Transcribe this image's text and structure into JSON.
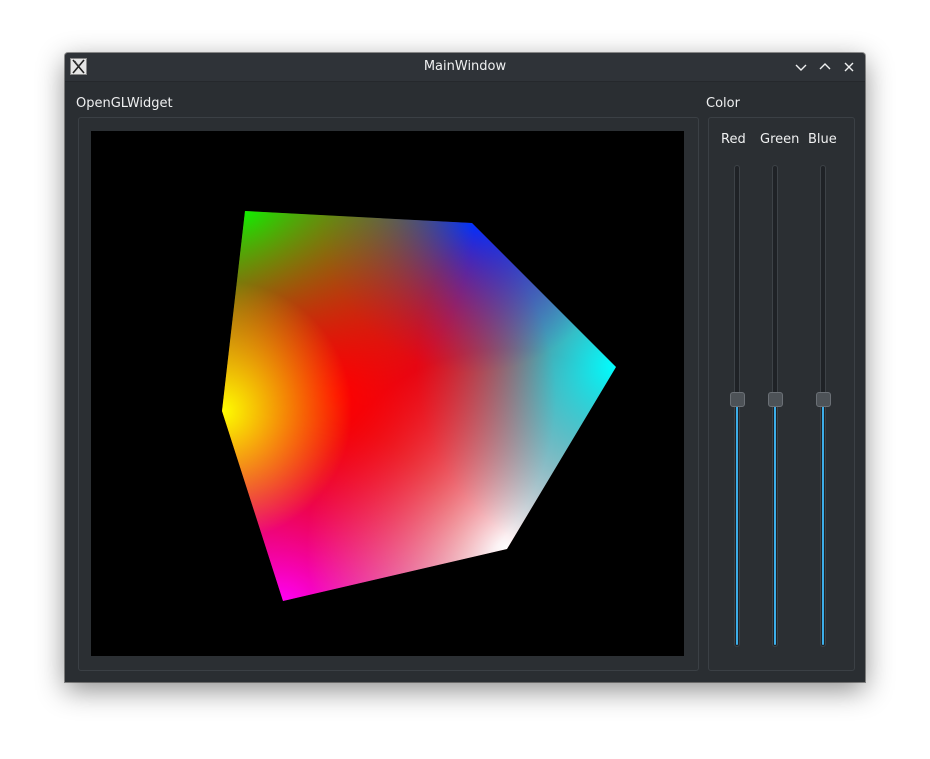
{
  "window": {
    "title": "MainWindow"
  },
  "titlebar": {
    "icons": [
      "app-icon",
      "minimize-icon",
      "maximize-icon",
      "close-icon"
    ]
  },
  "gl_section": {
    "label": "OpenGLWidget"
  },
  "color_section": {
    "label": "Color",
    "sliders": [
      {
        "label": "Red",
        "value_fraction": 0.5
      },
      {
        "label": "Green",
        "value_fraction": 0.5
      },
      {
        "label": "Blue",
        "value_fraction": 0.5
      }
    ]
  },
  "colors": {
    "window_bg": "#2a2e32",
    "accent": "#3daee9",
    "text": "#eff0f1"
  }
}
